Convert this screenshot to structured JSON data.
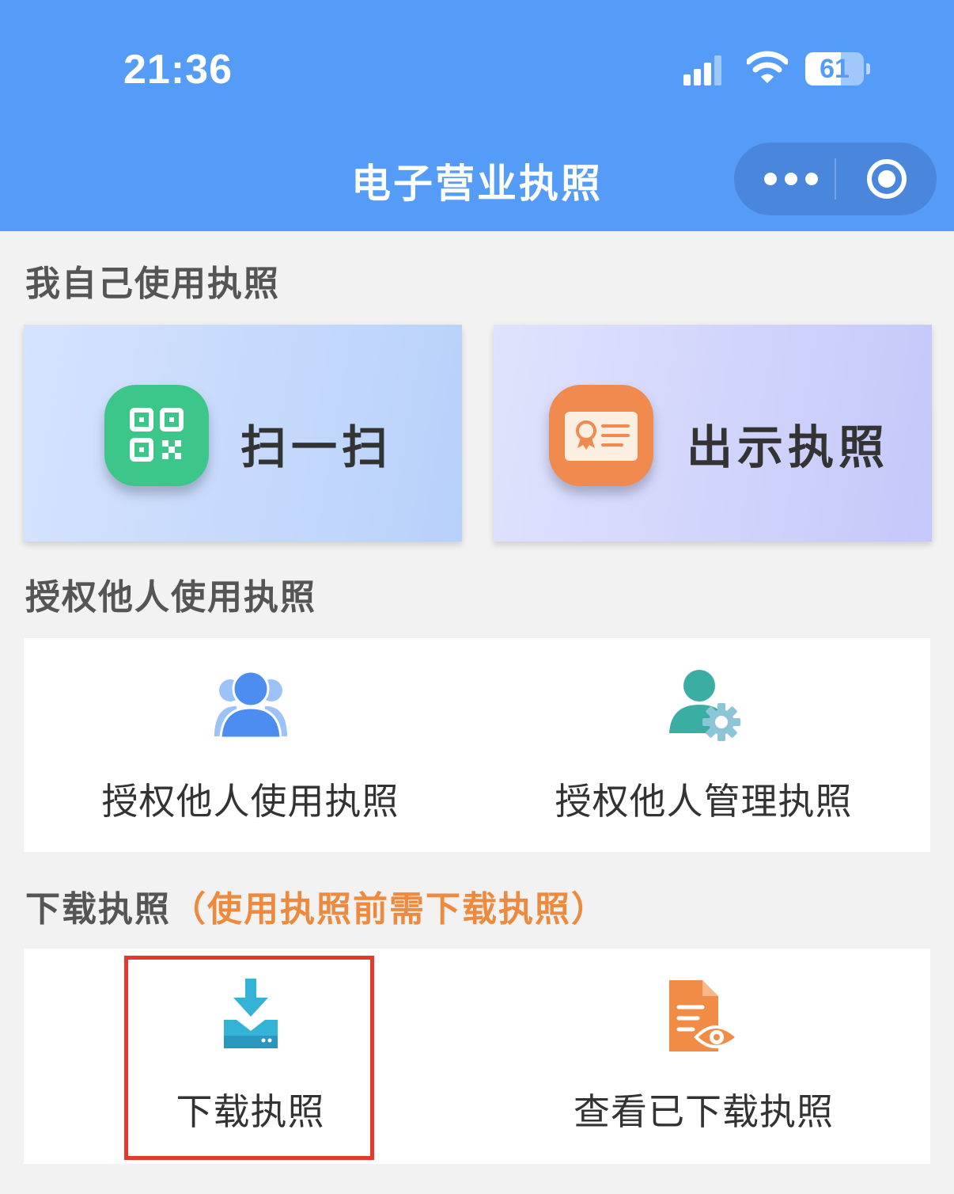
{
  "status_bar": {
    "time": "21:36",
    "battery": "61",
    "battery_level": 0.61,
    "icons": [
      "cellular-signal-icon",
      "wifi-icon",
      "battery-icon"
    ]
  },
  "nav": {
    "title": "电子营业执照",
    "capsule_icons": [
      "more-icon",
      "close-mini-program-icon"
    ]
  },
  "sections": {
    "self_use": "我自己使用执照",
    "authorize": "授权他人使用执照",
    "download": "下载执照",
    "download_note": "（使用执照前需下载执照）"
  },
  "self_use": {
    "scan": {
      "label": "扫一扫",
      "icon": "qr-code-icon"
    },
    "show": {
      "label": "出示执照",
      "icon": "license-card-icon"
    }
  },
  "authorize": {
    "use": {
      "label": "授权他人使用执照",
      "icon": "users-icon"
    },
    "manage": {
      "label": "授权他人管理执照",
      "icon": "user-settings-icon"
    }
  },
  "download": {
    "download": {
      "label": "下载执照",
      "icon": "download-icon"
    },
    "view": {
      "label": "查看已下载执照",
      "icon": "document-view-icon"
    }
  },
  "colors": {
    "header": "#559cf8",
    "scan_icon": "#3dc689",
    "show_icon": "#f08a4f",
    "note": "#ee8a3e",
    "highlight": "#e43a2b",
    "people_icon": "#4d8df2",
    "manage_icon": "#3aaea2",
    "download_icon": "#35b3d6",
    "view_icon": "#f08c45"
  }
}
